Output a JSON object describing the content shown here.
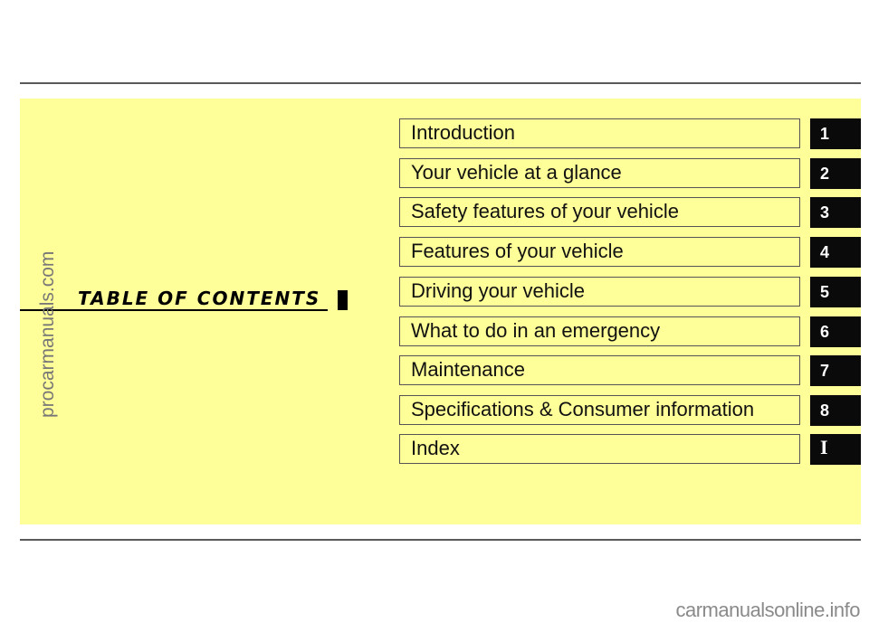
{
  "title": "TABLE OF CONTENTS",
  "entries": [
    {
      "label": "Introduction",
      "tab": "1"
    },
    {
      "label": "Your vehicle at a glance",
      "tab": "2"
    },
    {
      "label": "Safety features of your vehicle",
      "tab": "3"
    },
    {
      "label": "Features of your vehicle",
      "tab": "4"
    },
    {
      "label": "Driving your vehicle",
      "tab": "5"
    },
    {
      "label": "What to do in an emergency",
      "tab": "6"
    },
    {
      "label": "Maintenance",
      "tab": "7"
    },
    {
      "label": "Specifications & Consumer information",
      "tab": "8"
    },
    {
      "label": "Index",
      "tab": "I"
    }
  ],
  "watermarks": {
    "side": "procarmanuals.com",
    "bottom": "carmanualsonline.info"
  },
  "colors": {
    "panel": "#ffff99",
    "tab": "#0a0a0a"
  }
}
